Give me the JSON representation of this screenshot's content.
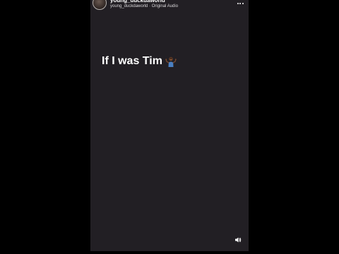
{
  "post": {
    "username": "young_duckdaworld",
    "subtitle": "young_duckdaworld · Original Audio",
    "caption": "If I was Tim",
    "caption_emoji_icon": "person-shrugging-icon",
    "more_icon": "more-horizontal-icon",
    "sound_icon": "speaker-icon"
  },
  "colors": {
    "background": "#000000",
    "video_background": "#221f24",
    "text": "#ffffff"
  }
}
